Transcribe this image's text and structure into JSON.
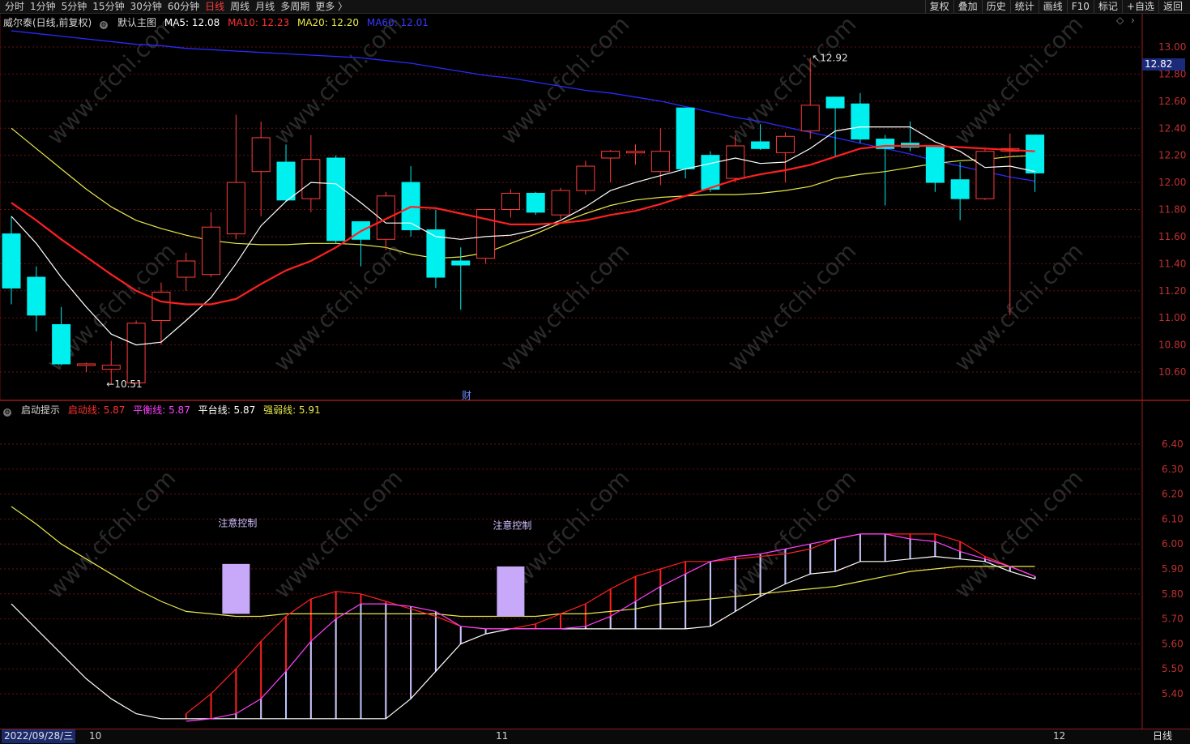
{
  "toolbar": {
    "tabs": [
      "分时",
      "1分钟",
      "5分钟",
      "15分钟",
      "30分钟",
      "60分钟",
      "日线",
      "周线",
      "月线",
      "多周期",
      "更多 〉"
    ],
    "active_tab": "日线",
    "right_buttons": [
      "复权",
      "叠加",
      "历史",
      "统计",
      "画线",
      "F10",
      "标记",
      "+自选",
      "返回"
    ]
  },
  "main_legend": {
    "stock": "威尔泰(日线,前复权)",
    "indicator": "默认主图",
    "ma5": "MA5: 12.08",
    "ma10": "MA10: 12.23",
    "ma20": "MA20: 12.20",
    "ma60": "MA60: 12.01"
  },
  "sub_legend": {
    "name": "启动提示",
    "qidong": "启动线: 5.87",
    "pingheng": "平衡线: 5.87",
    "pingtai": "平台线: 5.87",
    "qiangruo": "强弱线: 5.91"
  },
  "annotations": {
    "high_label": "12.92",
    "low_label": "10.51",
    "fin_marker": "财",
    "warn1": "注意控制",
    "warn2": "注意控制",
    "price_tag": "12.82"
  },
  "bottom": {
    "date": "2022/09/28/三",
    "month_labels": [
      "10",
      "11",
      "12"
    ],
    "period": "日线"
  },
  "colors": {
    "up": "#ff3c3c",
    "down": "#00f0f0",
    "ma5": "#ffffff",
    "ma10": "#ff2020",
    "ma20": "#e8e84a",
    "ma60": "#2a2aff",
    "magenta": "#ff40ff",
    "lavender": "#c8a8f8",
    "grid": "#6a0f0f"
  },
  "chart_data": [
    {
      "type": "candlestick",
      "title": "威尔泰(日线,前复权)",
      "ylim": [
        10.4,
        13.1
      ],
      "y_ticks": [
        "13.00",
        "12.80",
        "12.60",
        "12.40",
        "12.20",
        "12.00",
        "11.80",
        "11.60",
        "11.40",
        "11.20",
        "11.00",
        "10.80",
        "10.60"
      ],
      "candles": [
        {
          "o": 11.62,
          "h": 11.75,
          "l": 11.1,
          "c": 11.22
        },
        {
          "o": 11.3,
          "h": 11.38,
          "l": 10.9,
          "c": 11.02
        },
        {
          "o": 10.95,
          "h": 11.08,
          "l": 10.65,
          "c": 10.66
        },
        {
          "o": 10.65,
          "h": 10.67,
          "l": 10.6,
          "c": 10.66
        },
        {
          "o": 10.62,
          "h": 10.83,
          "l": 10.51,
          "c": 10.65
        },
        {
          "o": 10.52,
          "h": 10.98,
          "l": 10.51,
          "c": 10.96
        },
        {
          "o": 10.98,
          "h": 11.26,
          "l": 10.8,
          "c": 11.19
        },
        {
          "o": 11.3,
          "h": 11.48,
          "l": 11.2,
          "c": 11.42
        },
        {
          "o": 11.32,
          "h": 11.78,
          "l": 11.3,
          "c": 11.67
        },
        {
          "o": 11.62,
          "h": 12.5,
          "l": 11.58,
          "c": 12.0
        },
        {
          "o": 12.08,
          "h": 12.45,
          "l": 11.75,
          "c": 12.33
        },
        {
          "o": 12.15,
          "h": 12.28,
          "l": 11.86,
          "c": 11.87
        },
        {
          "o": 11.88,
          "h": 12.35,
          "l": 11.78,
          "c": 12.17
        },
        {
          "o": 12.18,
          "h": 12.2,
          "l": 11.55,
          "c": 11.57
        },
        {
          "o": 11.71,
          "h": 11.71,
          "l": 11.38,
          "c": 11.58
        },
        {
          "o": 11.58,
          "h": 11.93,
          "l": 11.5,
          "c": 11.9
        },
        {
          "o": 12.0,
          "h": 12.12,
          "l": 11.6,
          "c": 11.65
        },
        {
          "o": 11.65,
          "h": 11.8,
          "l": 11.22,
          "c": 11.3
        },
        {
          "o": 11.42,
          "h": 11.52,
          "l": 11.06,
          "c": 11.39
        },
        {
          "o": 11.44,
          "h": 11.8,
          "l": 11.4,
          "c": 11.8
        },
        {
          "o": 11.8,
          "h": 11.95,
          "l": 11.74,
          "c": 11.92
        },
        {
          "o": 11.92,
          "h": 11.93,
          "l": 11.76,
          "c": 11.78
        },
        {
          "o": 11.76,
          "h": 11.96,
          "l": 11.73,
          "c": 11.94
        },
        {
          "o": 11.94,
          "h": 12.16,
          "l": 11.91,
          "c": 12.12
        },
        {
          "o": 12.18,
          "h": 12.24,
          "l": 12.0,
          "c": 12.23
        },
        {
          "o": 12.22,
          "h": 12.28,
          "l": 12.13,
          "c": 12.23
        },
        {
          "o": 12.08,
          "h": 12.4,
          "l": 11.98,
          "c": 12.23
        },
        {
          "o": 12.55,
          "h": 12.55,
          "l": 12.03,
          "c": 12.1
        },
        {
          "o": 12.2,
          "h": 12.23,
          "l": 11.93,
          "c": 11.95
        },
        {
          "o": 12.03,
          "h": 12.35,
          "l": 12.0,
          "c": 12.27
        },
        {
          "o": 12.3,
          "h": 12.43,
          "l": 12.24,
          "c": 12.25
        },
        {
          "o": 12.22,
          "h": 12.37,
          "l": 12.0,
          "c": 12.34
        },
        {
          "o": 12.38,
          "h": 12.92,
          "l": 12.32,
          "c": 12.57
        },
        {
          "o": 12.63,
          "h": 12.63,
          "l": 12.19,
          "c": 12.55
        },
        {
          "o": 12.58,
          "h": 12.66,
          "l": 12.29,
          "c": 12.32
        },
        {
          "o": 12.32,
          "h": 12.35,
          "l": 11.83,
          "c": 12.25
        },
        {
          "o": 12.29,
          "h": 12.45,
          "l": 12.23,
          "c": 12.26
        },
        {
          "o": 12.26,
          "h": 12.26,
          "l": 11.93,
          "c": 12.0
        },
        {
          "o": 12.02,
          "h": 12.15,
          "l": 11.72,
          "c": 11.88
        },
        {
          "o": 11.88,
          "h": 12.25,
          "l": 11.87,
          "c": 12.23
        },
        {
          "o": 12.23,
          "h": 12.36,
          "l": 11.02,
          "c": 12.25
        },
        {
          "o": 12.35,
          "h": 12.35,
          "l": 11.93,
          "c": 12.07
        }
      ],
      "ma5": [
        11.75,
        11.55,
        11.3,
        11.08,
        10.88,
        10.8,
        10.82,
        10.98,
        11.15,
        11.4,
        11.68,
        11.86,
        12.0,
        11.99,
        11.85,
        11.7,
        11.7,
        11.6,
        11.58,
        11.6,
        11.61,
        11.65,
        11.72,
        11.82,
        11.94,
        12.0,
        12.05,
        12.1,
        12.14,
        12.18,
        12.14,
        12.15,
        12.25,
        12.38,
        12.41,
        12.41,
        12.41,
        12.3,
        12.23,
        12.11,
        12.12,
        12.08
      ],
      "ma10": [
        11.85,
        11.72,
        11.58,
        11.45,
        11.32,
        11.2,
        11.12,
        11.1,
        11.1,
        11.14,
        11.25,
        11.35,
        11.42,
        11.52,
        11.64,
        11.73,
        11.82,
        11.81,
        11.77,
        11.73,
        11.69,
        11.69,
        11.7,
        11.72,
        11.76,
        11.79,
        11.84,
        11.9,
        11.96,
        12.02,
        12.06,
        12.09,
        12.13,
        12.19,
        12.25,
        12.27,
        12.27,
        12.27,
        12.26,
        12.25,
        12.24,
        12.23
      ],
      "ma20": [
        12.4,
        12.25,
        12.1,
        11.95,
        11.82,
        11.72,
        11.66,
        11.61,
        11.57,
        11.55,
        11.54,
        11.54,
        11.55,
        11.55,
        11.54,
        11.52,
        11.47,
        11.44,
        11.45,
        11.48,
        11.55,
        11.62,
        11.7,
        11.77,
        11.83,
        11.87,
        11.89,
        11.9,
        11.91,
        11.91,
        11.92,
        11.94,
        11.97,
        12.03,
        12.06,
        12.08,
        12.11,
        12.14,
        12.16,
        12.17,
        12.19,
        12.2
      ],
      "ma60": [
        13.12,
        13.1,
        13.08,
        13.06,
        13.04,
        13.02,
        13.01,
        12.99,
        12.98,
        12.97,
        12.96,
        12.95,
        12.94,
        12.93,
        12.92,
        12.9,
        12.88,
        12.85,
        12.82,
        12.79,
        12.77,
        12.74,
        12.71,
        12.68,
        12.66,
        12.63,
        12.6,
        12.56,
        12.52,
        12.48,
        12.45,
        12.41,
        12.37,
        12.33,
        12.29,
        12.25,
        12.21,
        12.16,
        12.12,
        12.08,
        12.04,
        12.01
      ]
    },
    {
      "type": "line",
      "title": "启动提示",
      "ylim": [
        5.35,
        6.5
      ],
      "y_ticks": [
        "6.40",
        "6.30",
        "6.20",
        "6.10",
        "6.00",
        "5.90",
        "5.80",
        "5.70",
        "5.60",
        "5.50",
        "5.40"
      ],
      "series": [
        {
          "name": "启动线",
          "values": [
            null,
            null,
            null,
            null,
            null,
            null,
            null,
            5.32,
            5.4,
            5.5,
            5.61,
            5.71,
            5.78,
            5.81,
            5.8,
            5.77,
            5.74,
            5.71,
            5.67,
            5.66,
            5.66,
            5.68,
            5.72,
            5.76,
            5.82,
            5.87,
            5.9,
            5.93,
            5.93,
            5.94,
            5.95,
            5.96,
            5.98,
            6.02,
            6.04,
            6.04,
            6.04,
            6.04,
            6.01,
            5.95,
            5.91,
            5.87
          ]
        },
        {
          "name": "平衡线",
          "values": [
            null,
            null,
            null,
            null,
            null,
            null,
            null,
            5.29,
            5.3,
            5.32,
            5.38,
            5.49,
            5.61,
            5.7,
            5.76,
            5.76,
            5.75,
            5.73,
            5.67,
            5.66,
            5.66,
            5.66,
            5.66,
            5.67,
            5.71,
            5.77,
            5.83,
            5.88,
            5.93,
            5.95,
            5.96,
            5.98,
            6.0,
            6.02,
            6.04,
            6.04,
            6.02,
            6.01,
            5.97,
            5.94,
            5.91,
            5.87
          ]
        },
        {
          "name": "平台线",
          "values": [
            5.76,
            5.66,
            5.56,
            5.46,
            5.38,
            5.32,
            5.3,
            5.3,
            5.3,
            5.3,
            5.3,
            5.3,
            5.3,
            5.3,
            5.3,
            5.3,
            5.38,
            5.49,
            5.6,
            5.64,
            5.66,
            5.66,
            5.66,
            5.66,
            5.66,
            5.66,
            5.66,
            5.66,
            5.67,
            5.73,
            5.79,
            5.84,
            5.88,
            5.89,
            5.93,
            5.93,
            5.94,
            5.95,
            5.94,
            5.93,
            5.89,
            5.86
          ]
        },
        {
          "name": "强弱线",
          "values": [
            6.15,
            6.08,
            6.0,
            5.94,
            5.88,
            5.82,
            5.77,
            5.73,
            5.72,
            5.71,
            5.71,
            5.72,
            5.72,
            5.72,
            5.72,
            5.72,
            5.72,
            5.72,
            5.71,
            5.71,
            5.71,
            5.71,
            5.72,
            5.72,
            5.73,
            5.74,
            5.76,
            5.77,
            5.78,
            5.79,
            5.8,
            5.81,
            5.82,
            5.83,
            5.85,
            5.87,
            5.89,
            5.9,
            5.91,
            5.91,
            5.91,
            5.91
          ]
        }
      ],
      "signal_bars": [
        {
          "index": 9,
          "low": 5.72,
          "high": 5.92
        },
        {
          "index": 20,
          "low": 5.71,
          "high": 5.91
        }
      ]
    }
  ]
}
